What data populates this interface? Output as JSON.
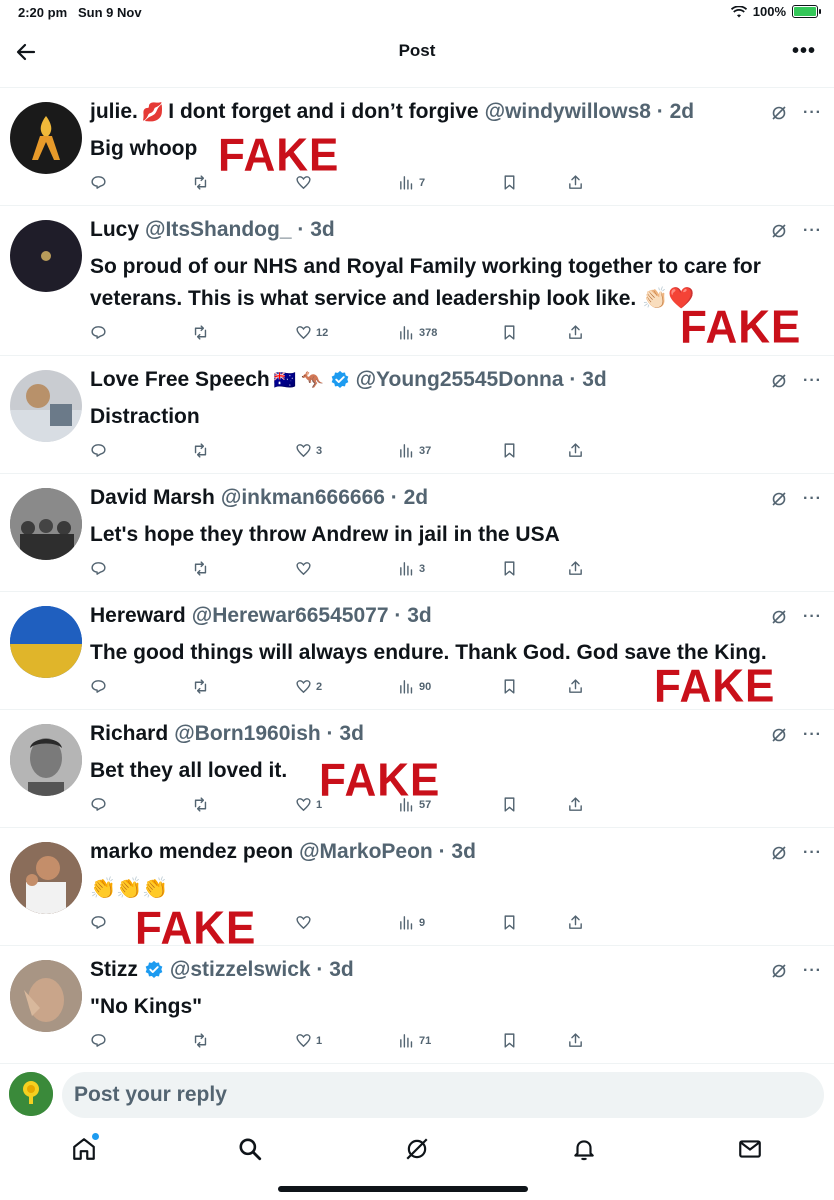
{
  "status_bar": {
    "time": "2:20 pm",
    "date": "Sun 9 Nov",
    "battery": "100%"
  },
  "header": {
    "title": "Post"
  },
  "replies": [
    {
      "name": "julie.",
      "name_emoji": "💋",
      "name_extra": "I dont forget and i don’t forgive",
      "handle": "@windywillows8",
      "age": "2d",
      "text": "Big whoop",
      "replies": "",
      "reposts": "",
      "likes": "",
      "views": "7",
      "fake": "FAKE"
    },
    {
      "name": "Lucy",
      "name_emoji": "",
      "name_extra": "",
      "handle": "@ItsShandog_",
      "age": "3d",
      "text": "So proud of our NHS and Royal Family working together to care for veterans. This is what service and leadership look like. 👏🏻❤️",
      "replies": "",
      "reposts": "",
      "likes": "12",
      "views": "378",
      "fake": "FAKE"
    },
    {
      "name": "Love Free Speech",
      "name_emoji": "🇦🇺 🦘",
      "name_extra": "",
      "handle": "@Young25545Donna",
      "age": "3d",
      "text": "Distraction",
      "replies": "",
      "reposts": "",
      "likes": "3",
      "views": "37",
      "fake": ""
    },
    {
      "name": "David Marsh",
      "name_emoji": "",
      "name_extra": "",
      "handle": "@inkman666666",
      "age": "2d",
      "text": "Let's hope they throw Andrew in jail in the USA",
      "replies": "",
      "reposts": "",
      "likes": "",
      "views": "3",
      "fake": ""
    },
    {
      "name": "Hereward",
      "name_emoji": "",
      "name_extra": "",
      "handle": "@Herewar66545077",
      "age": "3d",
      "text": "The good things will always endure. Thank God. God save the King.",
      "replies": "",
      "reposts": "",
      "likes": "2",
      "views": "90",
      "fake": "FAKE"
    },
    {
      "name": "Richard",
      "name_emoji": "",
      "name_extra": "",
      "handle": "@Born1960ish",
      "age": "3d",
      "text": "Bet they all loved it.",
      "replies": "",
      "reposts": "",
      "likes": "1",
      "views": "57",
      "fake": "FAKE"
    },
    {
      "name": "marko mendez peon",
      "name_emoji": "",
      "name_extra": "",
      "handle": "@MarkoPeon",
      "age": "3d",
      "text": "👏👏👏",
      "replies": "",
      "reposts": "",
      "likes": "",
      "views": "9",
      "fake": "FAKE"
    },
    {
      "name": "Stizz",
      "name_emoji": "",
      "name_extra": "",
      "handle": "@stizzelswick",
      "age": "3d",
      "text": "\"No Kings\"",
      "replies": "",
      "reposts": "",
      "likes": "1",
      "views": "71",
      "fake": ""
    }
  ],
  "composer": {
    "placeholder": "Post your reply",
    "avatar_caption": "Plaid Cymru Pontyclun & Rural"
  },
  "colors": {
    "accent": "#1d9bf0",
    "fake_red": "#c9101a",
    "muted": "#536471"
  }
}
